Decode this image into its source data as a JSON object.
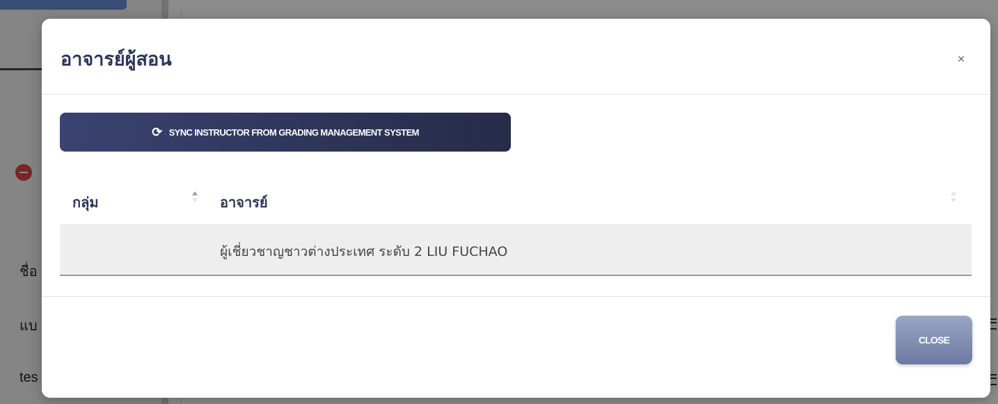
{
  "background": {
    "row_label_1": "ชื่อ",
    "row_label_2": "แบ",
    "row_label_3": "tes"
  },
  "modal": {
    "title": "อาจารย์ผู้สอน",
    "close_symbol": "×",
    "sync_button": {
      "icon": "sync-icon",
      "icon_glyph": "⟳",
      "label": "SYNC INSTRUCTOR FROM GRADING MANAGEMENT SYSTEM"
    },
    "table": {
      "columns": [
        {
          "label": "กลุ่ม"
        },
        {
          "label": "อาจารย์"
        }
      ],
      "rows": [
        {
          "group": "",
          "instructor": "ผู้เชี่ยวชาญชาวต่างประเทศ ระดับ 2 LIU FUCHAO"
        }
      ]
    },
    "footer": {
      "close_label": "CLOSE"
    }
  },
  "colors": {
    "primary_dark": "#2c3457",
    "sync_button": "#2e3559",
    "close_button": "#8491b4",
    "row_highlight": "#eeeeee"
  }
}
